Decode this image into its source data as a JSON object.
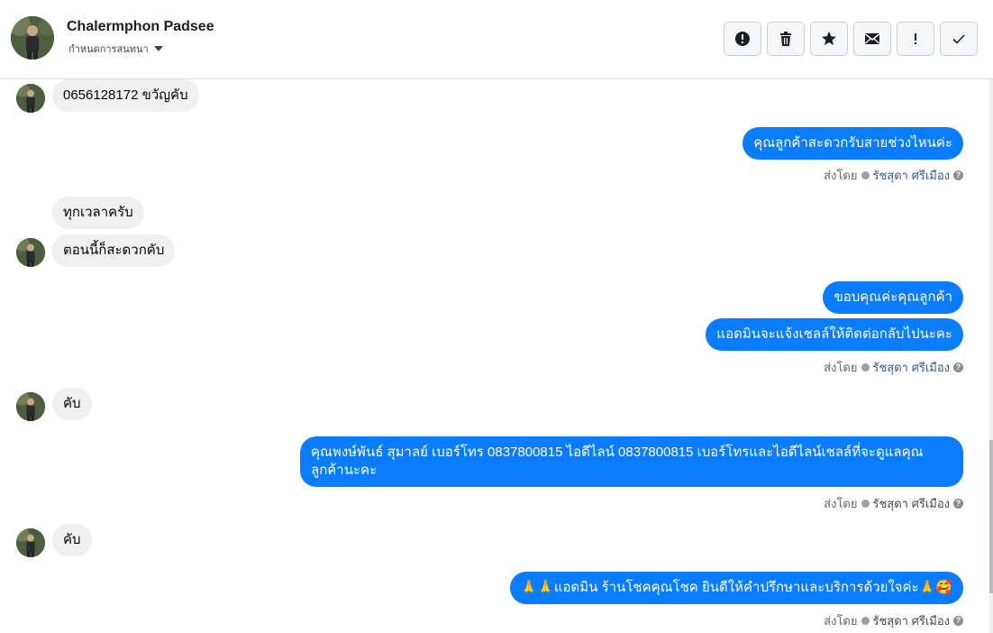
{
  "header": {
    "name": "Chalermphon Padsee",
    "subtitle": "กำหนดการสนทนา"
  },
  "toolbar": {
    "icons": [
      "alert-circle-icon",
      "trash-icon",
      "star-icon",
      "mail-icon",
      "exclamation-icon",
      "check-icon"
    ]
  },
  "messages": {
    "in_1": "0656128172 ขวัญคับ",
    "out_1": "คุณลูกค้าสะดวกรับสายช่วงไหนค่ะ",
    "in_2": "ทุกเวลาครับ",
    "in_3": "ตอนนี้ก็สะดวกคับ",
    "out_2": "ขอบคุณค่ะคุณลูกค้า",
    "out_3": "แอดมินจะแจ้งเชลล์ให้ติดต่อกลับไปนะคะ",
    "in_4": "คับ",
    "out_4": "คุณพงษ์พันธ์ สุมาลย์      เบอร์โทร 0837800815  ไอดีไลน์ 0837800815   เบอร์โทรและไอดีไลน์เชลล์ที่จะดูแลคุณลูกค้านะคะ",
    "in_5": "คับ",
    "out_5": "🙏🙏แอดมิน ร้านโชคคุณโชค ยินดีให้คำปรึกษาและบริการด้วยใจค่ะ🙏🥰"
  },
  "sent_by": {
    "label": "ส่งโดย",
    "name": "รัชสุดา ศรีเมือง"
  },
  "colors": {
    "outgoing_bubble": "#0a7cff",
    "incoming_bubble": "#f0f0f0"
  }
}
